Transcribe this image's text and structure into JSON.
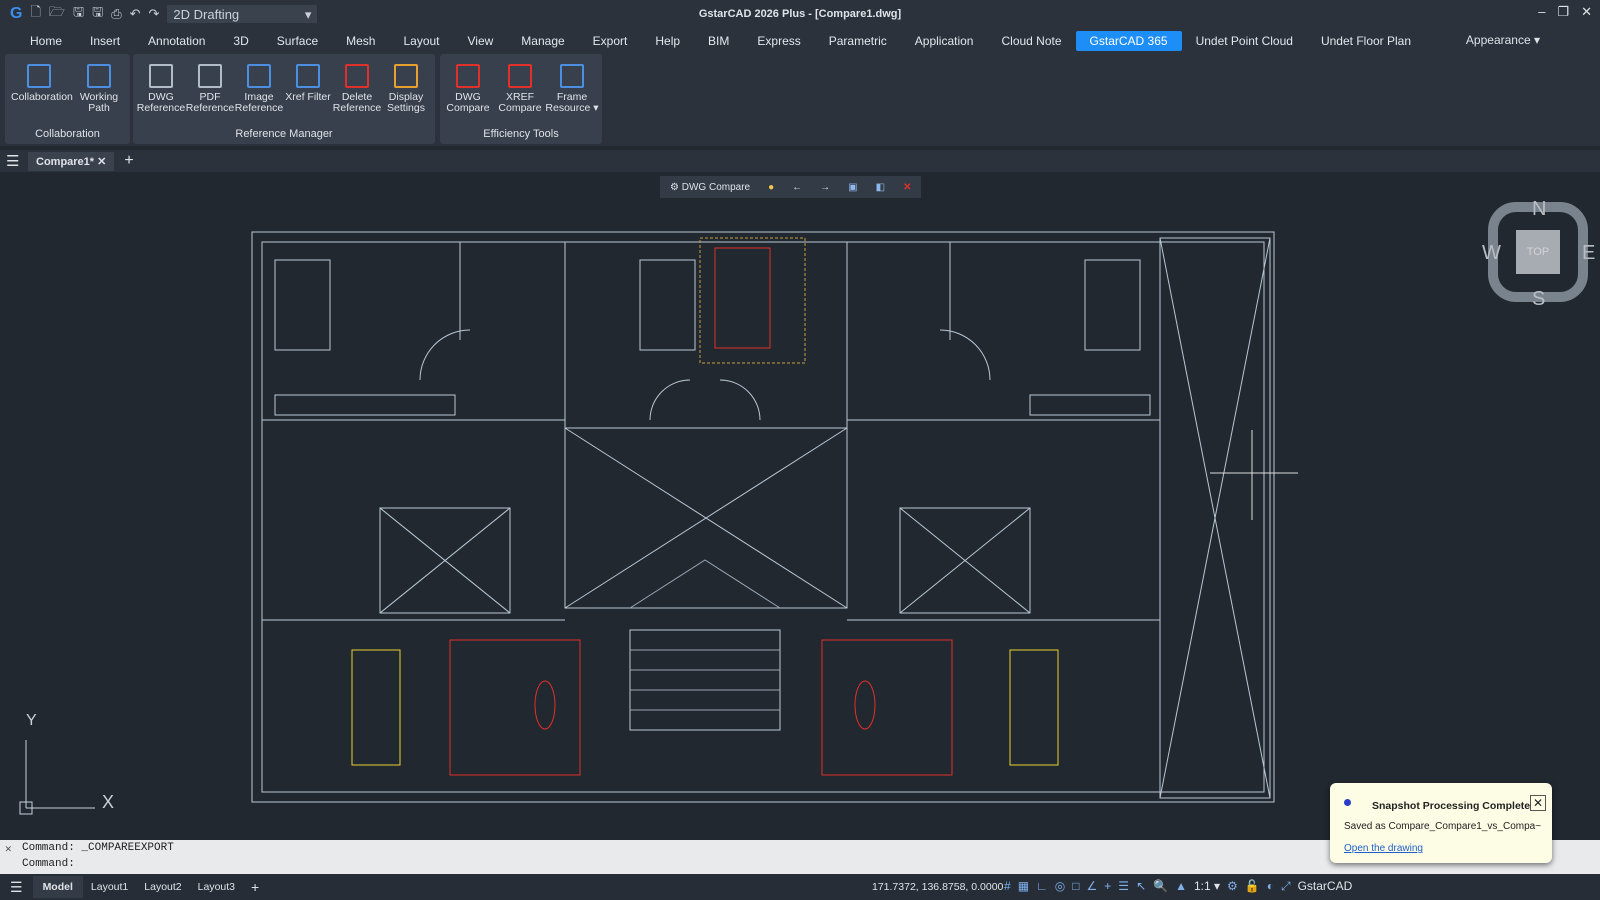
{
  "titlebar": {
    "title": "GstarCAD 2026 Plus - [Compare1.dwg]",
    "workspace": "2D Drafting"
  },
  "menu": [
    {
      "label": "Home"
    },
    {
      "label": "Insert"
    },
    {
      "label": "Annotation"
    },
    {
      "label": "3D"
    },
    {
      "label": "Surface"
    },
    {
      "label": "Mesh"
    },
    {
      "label": "Layout"
    },
    {
      "label": "View"
    },
    {
      "label": "Manage"
    },
    {
      "label": "Export"
    },
    {
      "label": "Help"
    },
    {
      "label": "BIM"
    },
    {
      "label": "Express"
    },
    {
      "label": "Parametric"
    },
    {
      "label": "Application"
    },
    {
      "label": "Cloud Note"
    },
    {
      "label": "GstarCAD 365",
      "active": true
    },
    {
      "label": "Undet Point Cloud"
    },
    {
      "label": "Undet Floor Plan"
    }
  ],
  "appearance": "Appearance ▾",
  "ribbon": {
    "collaboration": {
      "title": "Collaboration",
      "tools": [
        "Collaboration",
        "Working Path"
      ]
    },
    "reference": {
      "title": "Reference Manager",
      "tools": [
        "DWG Reference",
        "PDF Reference",
        "Image Reference",
        "Xref Filter",
        "Delete Reference",
        "Display Settings"
      ]
    },
    "efficiency": {
      "title": "Efficiency Tools",
      "tools": [
        "DWG Compare",
        "XREF Compare",
        "Frame Resource ▾"
      ]
    }
  },
  "doc_tab": "Compare1*",
  "compare_toolbar": {
    "label": "DWG Compare"
  },
  "viewcube": {
    "n": "N",
    "s": "S",
    "e": "E",
    "w": "W",
    "top": "TOP"
  },
  "ucs": {
    "x": "X",
    "y": "Y"
  },
  "command": {
    "line1": "Command: _COMPAREEXPORT",
    "line2": "Command:"
  },
  "status": {
    "layouts": [
      "Model",
      "Layout1",
      "Layout2",
      "Layout3"
    ],
    "coords": "171.7372, 136.8758, 0.0000",
    "scale": "1:1 ▾",
    "app": "GstarCAD"
  },
  "toast": {
    "title": "Snapshot Processing Complete",
    "body": "Saved as Compare_Compare1_vs_Compa~",
    "link": "Open the drawing"
  },
  "colors": {
    "accent": "#1d8ef5",
    "changed": "#e0302a",
    "added": "#e8d12c",
    "lines": "#c8d2dc"
  }
}
